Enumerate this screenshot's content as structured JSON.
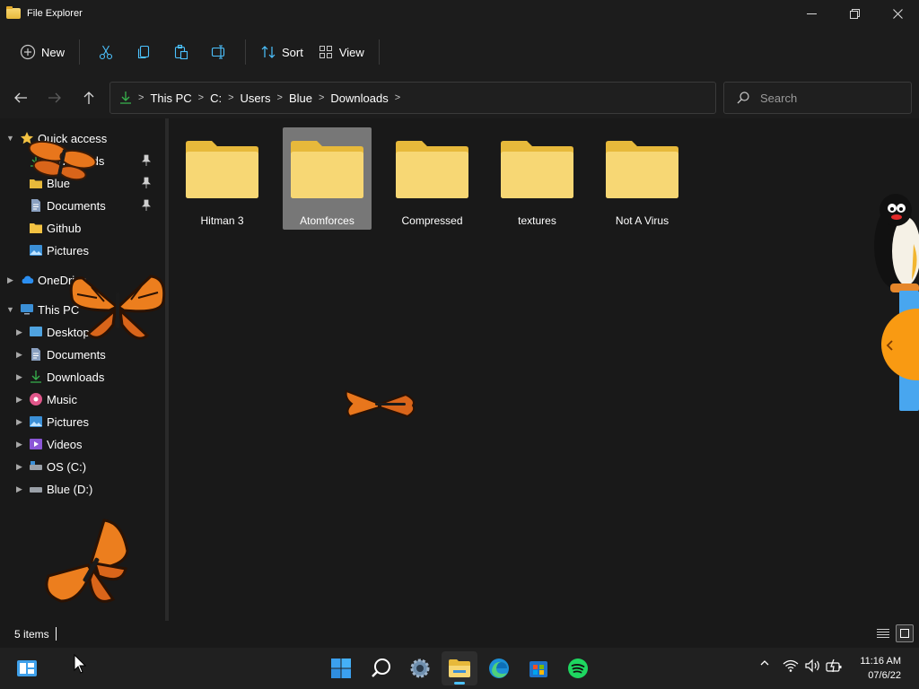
{
  "window": {
    "title": "File Explorer",
    "minimize_glyph": "—",
    "maximize_glyph": "❐",
    "close_glyph": "✕"
  },
  "commandbar": {
    "new_label": "New",
    "sort_label": "Sort",
    "view_label": "View"
  },
  "address": {
    "crumbs": [
      "This PC",
      "C:",
      "Users",
      "Blue",
      "Downloads"
    ]
  },
  "search": {
    "placeholder": "Search"
  },
  "sidebar": {
    "quick_access": "Quick access",
    "quick_items": [
      "Downloads",
      "Blue",
      "Documents",
      "Github",
      "Pictures"
    ],
    "onedrive": "OneDrive",
    "this_pc": "This PC",
    "pc_items": [
      "Desktop",
      "Documents",
      "Downloads",
      "Music",
      "Pictures",
      "Videos",
      "OS (C:)",
      "Blue (D:)"
    ]
  },
  "folders": [
    {
      "name": "Hitman 3",
      "selected": false
    },
    {
      "name": "Atomforces",
      "selected": true
    },
    {
      "name": "Compressed",
      "selected": false
    },
    {
      "name": "textures",
      "selected": false
    },
    {
      "name": "Not A Virus",
      "selected": false
    }
  ],
  "status": {
    "item_count": "5 items"
  },
  "taskbar": {
    "time": "11:16 AM",
    "date": "07/6/22",
    "apps": [
      "start-icon",
      "search-icon",
      "settings-icon",
      "file-explorer-icon",
      "edge-icon",
      "store-icon",
      "spotify-icon"
    ]
  },
  "colors": {
    "folder": "#f5c84a",
    "accent": "#4cc2ff",
    "background": "#191919"
  }
}
